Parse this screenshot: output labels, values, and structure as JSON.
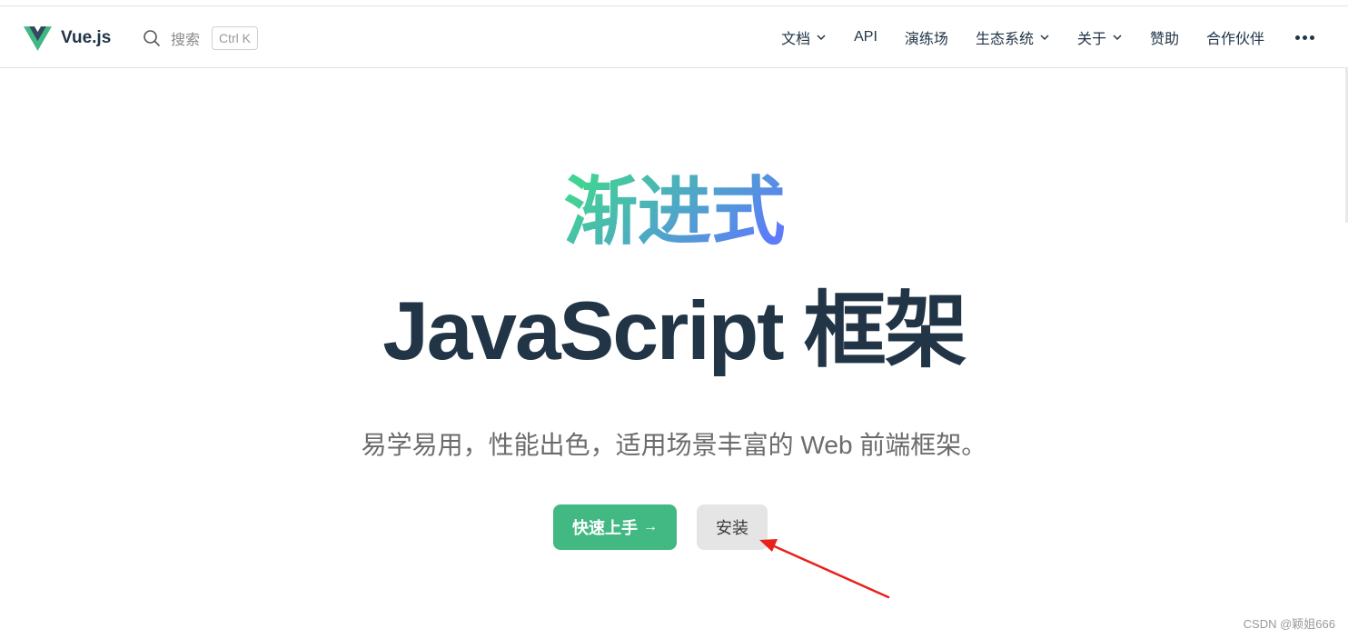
{
  "navbar": {
    "brand": "Vue.js",
    "search_label": "搜索",
    "search_shortcut": "Ctrl K",
    "items": [
      {
        "label": "文档",
        "dropdown": true
      },
      {
        "label": "API",
        "dropdown": false
      },
      {
        "label": "演练场",
        "dropdown": false
      },
      {
        "label": "生态系统",
        "dropdown": true
      },
      {
        "label": "关于",
        "dropdown": true
      },
      {
        "label": "赞助",
        "dropdown": false
      },
      {
        "label": "合作伙伴",
        "dropdown": false
      }
    ]
  },
  "hero": {
    "tagline_highlight": "渐进式",
    "tagline_main": "JavaScript 框架",
    "subtitle": "易学易用，性能出色，适用场景丰富的 Web 前端框架。",
    "primary_button": "快速上手",
    "primary_button_arrow": "→",
    "secondary_button": "安装"
  },
  "watermark": "CSDN @颖姐666",
  "colors": {
    "brand_green": "#42b883",
    "text_dark": "#213547",
    "gradient_start": "#42d392",
    "gradient_end": "#647eff",
    "annotation_red": "#e8211b"
  }
}
